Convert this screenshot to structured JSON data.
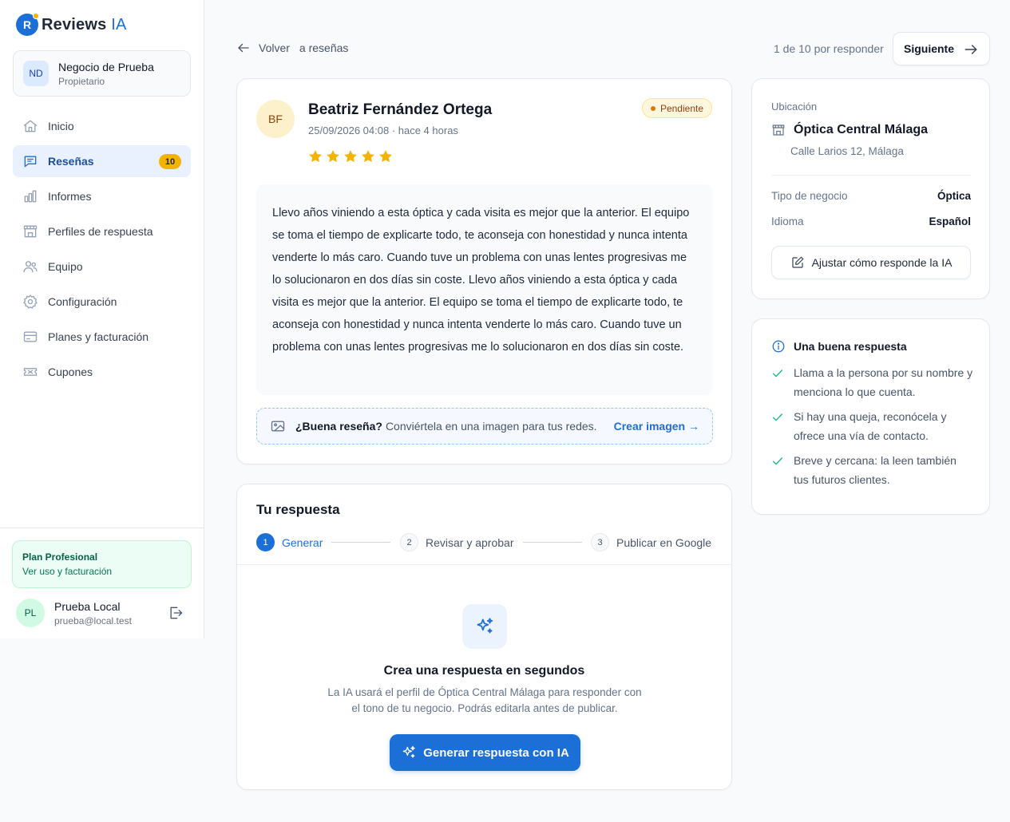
{
  "app": {
    "name_main": "Reviews",
    "name_accent": "IA",
    "logo_letter": "R",
    "brand_color": "#1d6fd8",
    "accent_color": "#f5b301"
  },
  "business": {
    "initials": "ND",
    "name": "Negocio de Prueba",
    "role": "Propietario"
  },
  "nav": {
    "items": [
      {
        "label": "Inicio",
        "icon": "home-icon"
      },
      {
        "label": "Reseñas",
        "icon": "chat-icon",
        "badge": "10",
        "active": true
      },
      {
        "label": "Informes",
        "icon": "bar-chart-icon"
      },
      {
        "label": "Perfiles de respuesta",
        "icon": "store-icon"
      },
      {
        "label": "Equipo",
        "icon": "users-icon"
      },
      {
        "label": "Configuración",
        "icon": "gear-icon"
      },
      {
        "label": "Planes y facturación",
        "icon": "credit-card-icon"
      },
      {
        "label": "Cupones",
        "icon": "ticket-icon"
      }
    ]
  },
  "plan": {
    "name": "Plan Profesional",
    "link": "Ver uso y facturación"
  },
  "user": {
    "initials": "PL",
    "name": "Prueba Local",
    "email": "prueba@local.test"
  },
  "topbar": {
    "back_label": "Volver",
    "back_suffix": "a reseñas",
    "counter": "1 de 10 por responder",
    "next_label": "Siguiente"
  },
  "review": {
    "initials": "BF",
    "author": "Beatriz Fernández Ortega",
    "date": "25/09/2026 04:08 · hace 4 horas",
    "rating": 5,
    "status": "Pendiente",
    "text": "Llevo años viniendo a esta óptica y cada visita es mejor que la anterior. El equipo se toma el tiempo de explicarte todo, te aconseja con honestidad y nunca intenta venderte lo más caro. Cuando tuve un problema con unas lentes progresivas me lo solucionaron en dos días sin coste. Llevo años viniendo a esta óptica y cada visita es mejor que la anterior. El equipo se toma el tiempo de explicarte todo, te aconseja con honestidad y nunca intenta venderte lo más caro. Cuando tuve un problema con unas lentes progresivas me lo solucionaron en dos días sin coste.",
    "promo_bold": "¿Buena reseña?",
    "promo_text": "Conviértela en una imagen para tus redes.",
    "promo_link": "Crear imagen →"
  },
  "response": {
    "title": "Tu respuesta",
    "steps": [
      {
        "num": "1",
        "label": "Generar",
        "active": true
      },
      {
        "num": "2",
        "label": "Revisar y aprobar"
      },
      {
        "num": "3",
        "label": "Publicar en Google"
      }
    ],
    "empty_title": "Crea una respuesta en segundos",
    "empty_desc": "La IA usará el perfil de Óptica Central Málaga para responder con el tono de tu negocio. Podrás editarla antes de publicar.",
    "generate_label": "Generar respuesta con IA"
  },
  "location": {
    "label": "Ubicación",
    "name": "Óptica Central Málaga",
    "address": "Calle Larios 12, Málaga",
    "business_type_label": "Tipo de negocio",
    "business_type": "Óptica",
    "language_label": "Idioma",
    "language": "Español",
    "adjust_label": "Ajustar cómo responde la IA"
  },
  "tips": {
    "title": "Una buena respuesta",
    "items": [
      "Llama a la persona por su nombre y menciona lo que cuenta.",
      "Si hay una queja, reconócela y ofrece una vía de contacto.",
      "Breve y cercana: la leen también tus futuros clientes."
    ]
  }
}
